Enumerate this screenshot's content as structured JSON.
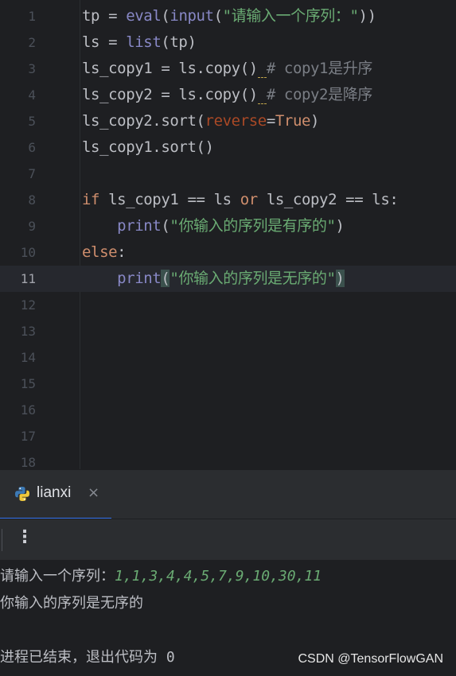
{
  "editor": {
    "line_numbers": [
      "1",
      "2",
      "3",
      "4",
      "5",
      "6",
      "7",
      "8",
      "9",
      "10",
      "11",
      "12",
      "13",
      "14",
      "15",
      "16",
      "17",
      "18"
    ],
    "current_line": "11"
  },
  "code": {
    "l1": {
      "a": "tp = ",
      "b": "eval",
      "c": "(",
      "d": "input",
      "e": "(",
      "f": "\"请输入一个序列：\"",
      "g": "))"
    },
    "l2": {
      "a": "ls = ",
      "b": "list",
      "c": "(tp)"
    },
    "l3": {
      "a": "ls_copy1 = ls.copy()",
      "b": " ",
      "c": "# copy1是升序"
    },
    "l4": {
      "a": "ls_copy2 = ls.copy()",
      "b": " ",
      "c": "# copy2是降序"
    },
    "l5": {
      "a": "ls_copy2.sort(",
      "b": "reverse",
      "c": "=",
      "d": "True",
      "e": ")"
    },
    "l6": {
      "a": "ls_copy1.sort()"
    },
    "l8": {
      "a": "if",
      "b": " ls_copy1 == ls ",
      "c": "or",
      "d": " ls_copy2 == ls:"
    },
    "l9": {
      "a": "    ",
      "b": "print",
      "c": "(",
      "d": "\"你输入的序列是有序的\"",
      "e": ")"
    },
    "l10": {
      "a": "else",
      "b": ":"
    },
    "l11": {
      "a": "    ",
      "b": "print",
      "c": "(",
      "d": "\"你输入的序列是无序的\"",
      "e": ")"
    }
  },
  "run_panel": {
    "tab_label": "lianxi",
    "tab_icon": "python-icon",
    "close_glyph": "×",
    "menu_glyph": "⋮"
  },
  "console": {
    "prompt": "请输入一个序列：",
    "input_value": "1,1,3,4,4,5,7,9,10,30,11",
    "output": "你输入的序列是无序的",
    "exit_message": "进程已结束，退出代码为 0"
  },
  "watermark": "CSDN @TensorFlowGAN",
  "colors": {
    "background": "#1e1f22",
    "keyword": "#cf8e6d",
    "builtin": "#8888c6",
    "string": "#6aab73",
    "comment": "#7a7e85",
    "param": "#aa4926",
    "accent": "#3574f0"
  }
}
